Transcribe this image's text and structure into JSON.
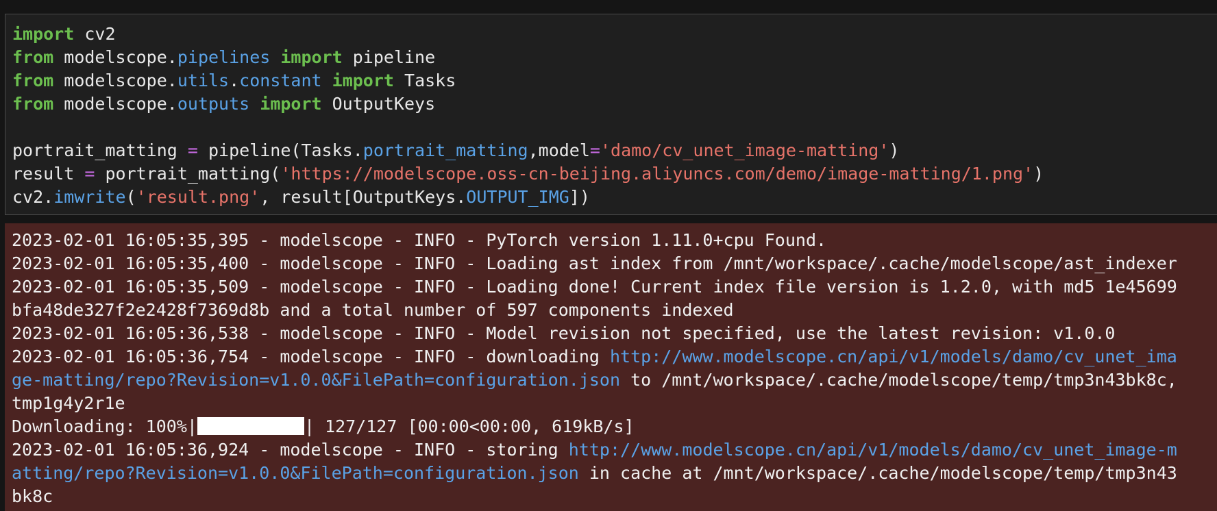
{
  "code_cell": {
    "lines": [
      {
        "kw1": "import",
        "rest": " cv2"
      },
      {
        "kw1": "from",
        "mod": " modelscope.",
        "attr": "pipelines",
        "sp": " ",
        "kw2": "import",
        "rest": " pipeline"
      },
      {
        "kw1": "from",
        "mod": " modelscope.",
        "attr": "utils",
        "dot": ".",
        "attr2": "constant",
        "sp": " ",
        "kw2": "import",
        "rest": " Tasks"
      },
      {
        "kw1": "from",
        "mod": " modelscope.",
        "attr": "outputs",
        "sp": " ",
        "kw2": "import",
        "rest": " OutputKeys"
      },
      {
        "empty": ""
      },
      {
        "a": "portrait_matting ",
        "op": "=",
        "b": " pipeline(Tasks.",
        "attr": "portrait_matting",
        "c": ",model",
        "op2": "=",
        "str": "'damo/cv_unet_image-matting'",
        "d": ")"
      },
      {
        "a": "result ",
        "op": "=",
        "b": " portrait_matting(",
        "str": "'https://modelscope.oss-cn-beijing.aliyuncs.com/demo/image-matting/1.png'",
        "d": ")"
      },
      {
        "a": "cv2.",
        "attr": "imwrite",
        "b": "(",
        "str": "'result.png'",
        "c": ", result[OutputKeys.",
        "attr2": "OUTPUT_IMG",
        "d": "])"
      }
    ]
  },
  "output": {
    "lines": [
      "2023-02-01 16:05:35,395 - modelscope - INFO - PyTorch version 1.11.0+cpu Found.",
      "2023-02-01 16:05:35,400 - modelscope - INFO - Loading ast index from /mnt/workspace/.cache/modelscope/ast_indexer",
      "2023-02-01 16:05:35,509 - modelscope - INFO - Loading done! Current index file version is 1.2.0, with md5 1e45699",
      "bfa48de327f2e2428f7369d8b and a total number of 597 components indexed",
      "2023-02-01 16:05:36,538 - modelscope - INFO - Model revision not specified, use the latest revision: v1.0.0"
    ],
    "download1_prefix": "2023-02-01 16:05:36,754 - modelscope - INFO - downloading ",
    "download1_link_a": "http://www.modelscope.cn/api/v1/models/damo/cv_unet_ima",
    "download1_link_b": "ge-matting/repo?Revision=v1.0.0&FilePath=configuration.json",
    "download1_suffix": " to /mnt/workspace/.cache/modelscope/temp/tmp3n43bk8c,",
    "download1_tail": "tmp1g4y2r1e",
    "progress_prefix": "Downloading: 100%|",
    "progress_value": 1.0,
    "progress_suffix": "| 127/127 [00:00<00:00, 619kB/s]",
    "store_prefix": "2023-02-01 16:05:36,924 - modelscope - INFO - storing ",
    "store_link_a": "http://www.modelscope.cn/api/v1/models/damo/cv_unet_image-m",
    "store_link_b": "atting/repo?Revision=v1.0.0&FilePath=configuration.json",
    "store_suffix": " in cache at /mnt/workspace/.cache/modelscope/temp/tmp3n43",
    "store_tail": "bk8c"
  }
}
